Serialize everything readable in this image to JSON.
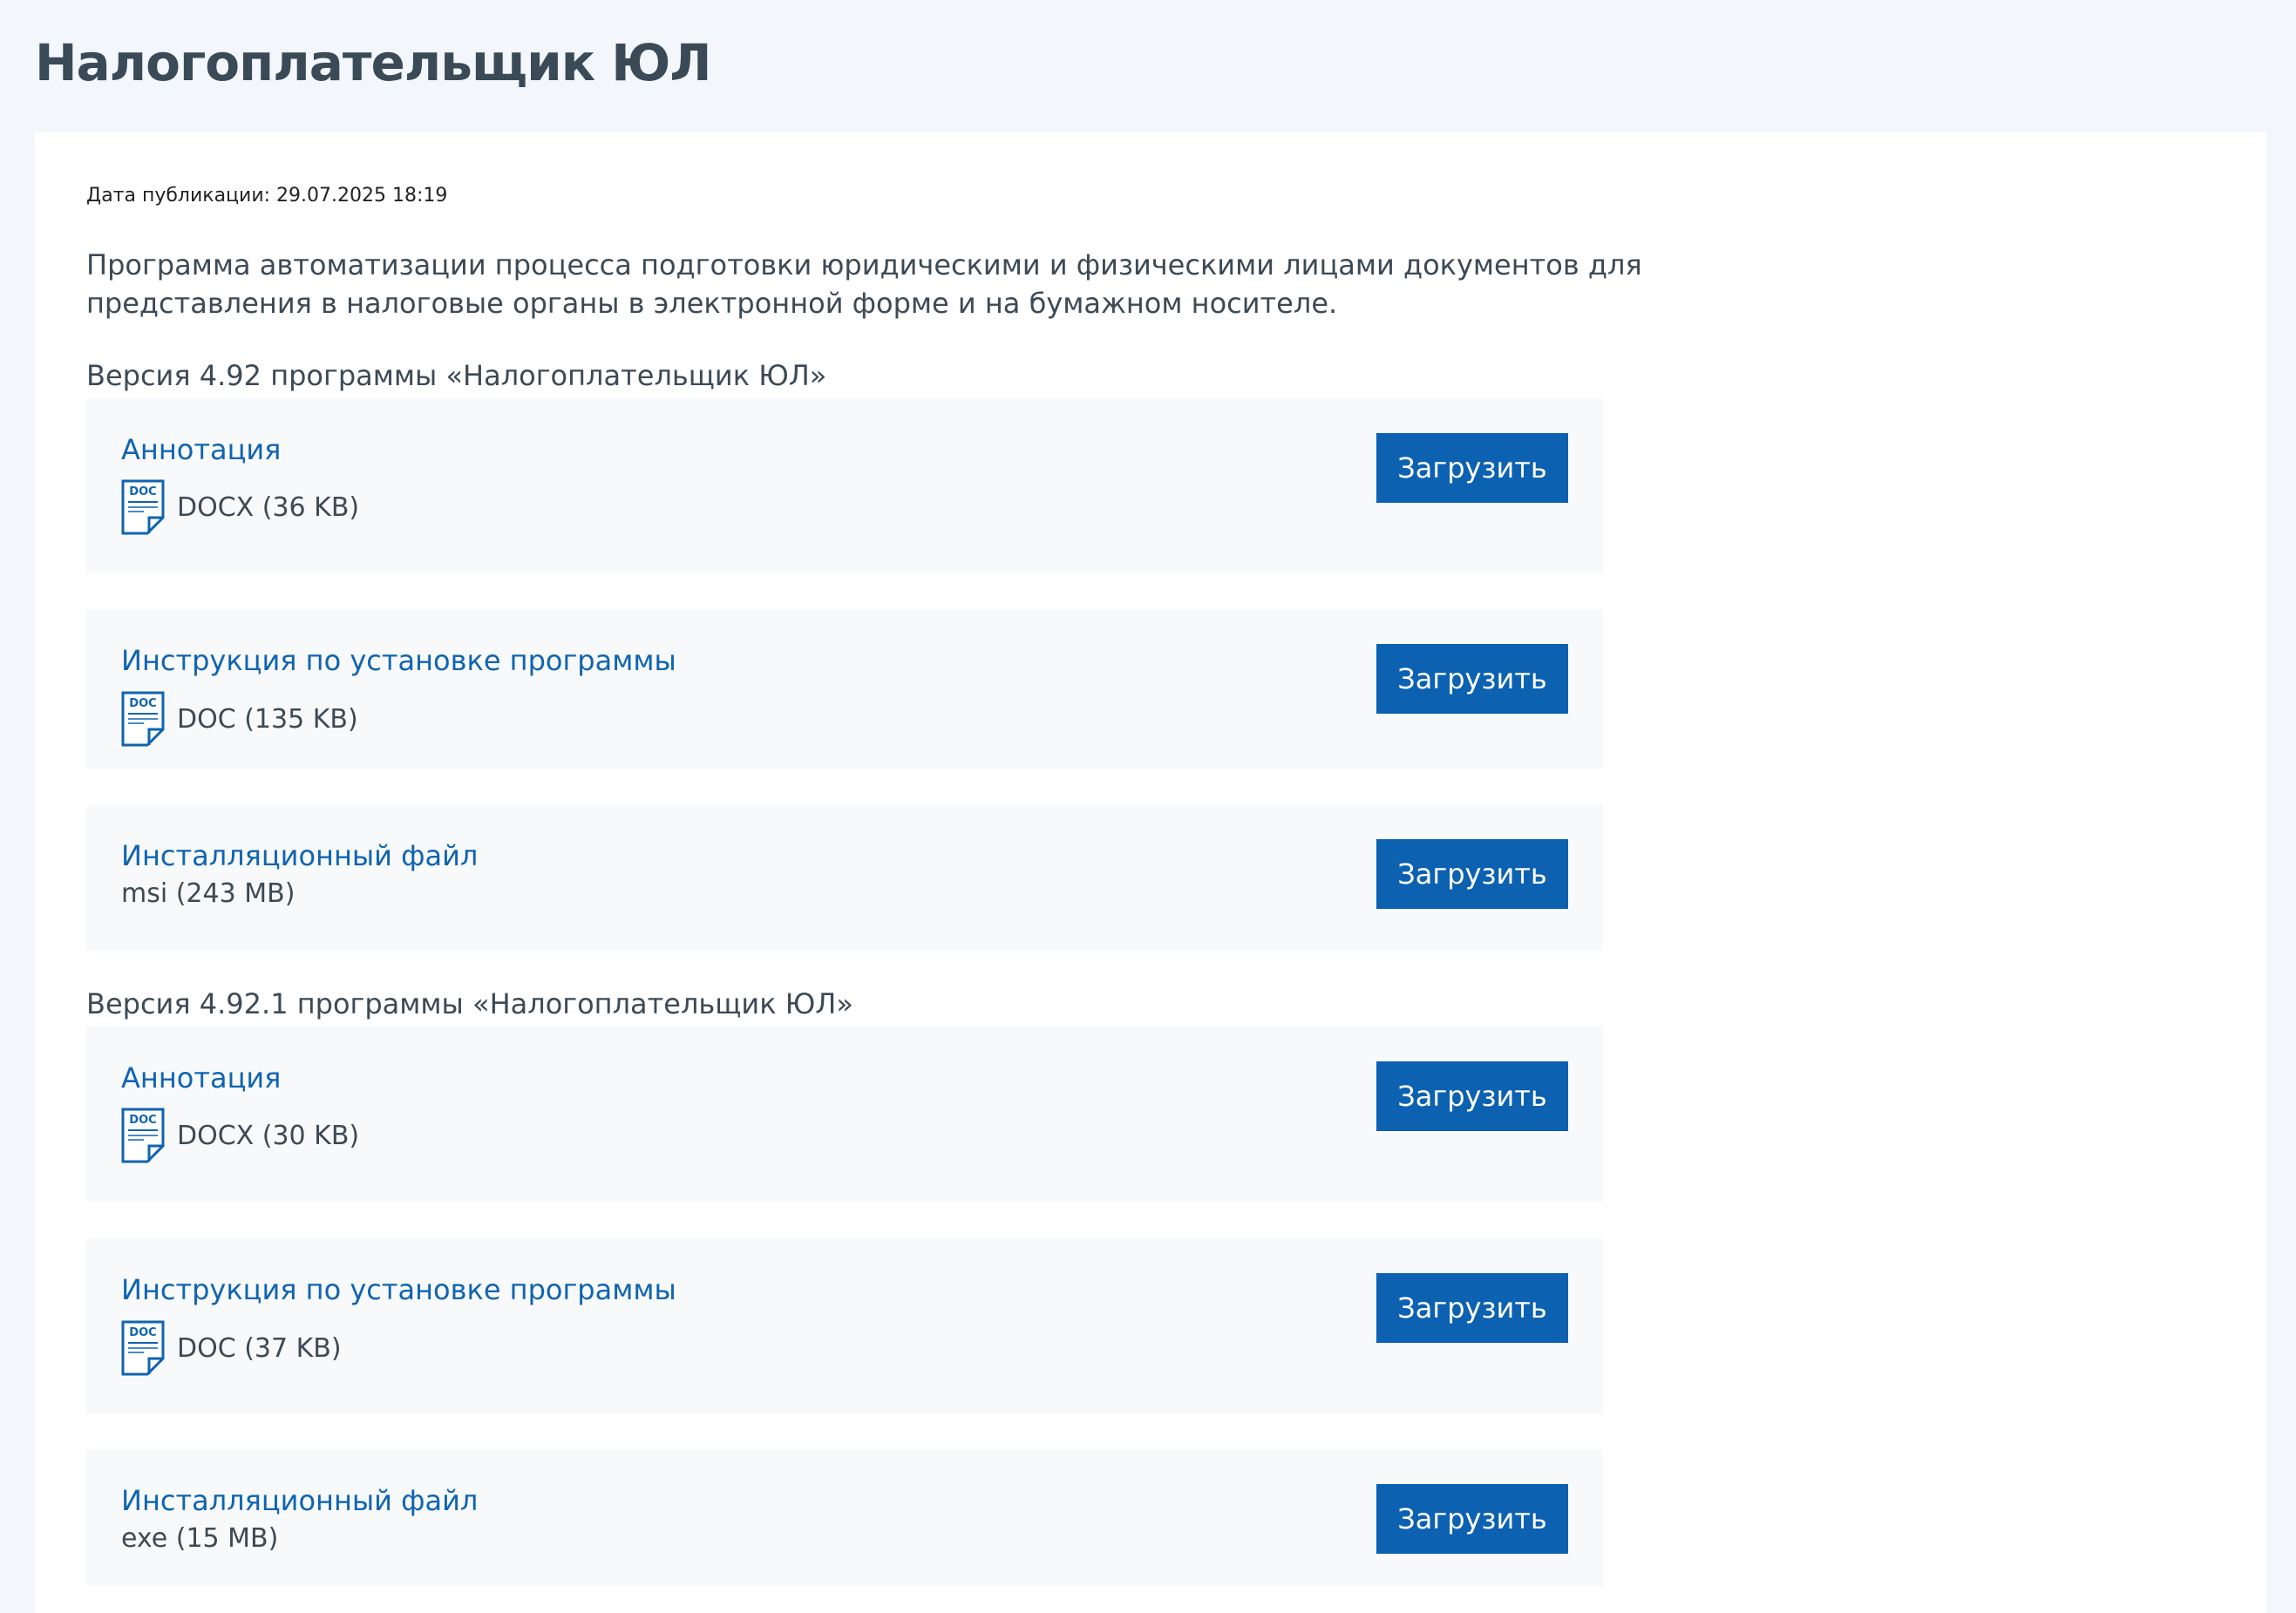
{
  "page": {
    "title": "Налогоплательщик ЮЛ",
    "publication_date": "Дата публикации: 29.07.2025 18:19",
    "description": "Программа автоматизации процесса подготовки юридическими и физическими лицами документов для представления в налоговые органы в электронной форме и на бумажном носителе."
  },
  "colors": {
    "accent": "#0c61b1",
    "link": "#0f64b1",
    "block_bg": "#f8f9fa",
    "page_bg": "#f3f6fa"
  },
  "versions": [
    {
      "title": "Версия 4.92 программы «Налогоплательщик ЮЛ»",
      "files": [
        {
          "name": "Аннотация",
          "meta": "DOCX (36 KB)",
          "icon": "doc-file-icon",
          "icon_label": "DOC",
          "button": "Загрузить"
        },
        {
          "name": "Инструкция по установке программы",
          "meta": "DOC (135 KB)",
          "icon": "doc-file-icon",
          "icon_label": "DOC",
          "button": "Загрузить"
        },
        {
          "name": "Инсталляционный файл",
          "meta": "msi (243 MB)",
          "button": "Загрузить"
        }
      ]
    },
    {
      "title": "Версия 4.92.1 программы «Налогоплательщик ЮЛ»",
      "files": [
        {
          "name": "Аннотация",
          "meta": "DOCX (30 KB)",
          "icon": "doc-file-icon",
          "icon_label": "DOC",
          "button": "Загрузить"
        },
        {
          "name": "Инструкция по установке программы",
          "meta": "DOC (37 KB)",
          "icon": "doc-file-icon",
          "icon_label": "DOC",
          "button": "Загрузить"
        },
        {
          "name": "Инсталляционный файл",
          "meta": "exe (15 MB)",
          "button": "Загрузить"
        }
      ]
    }
  ]
}
